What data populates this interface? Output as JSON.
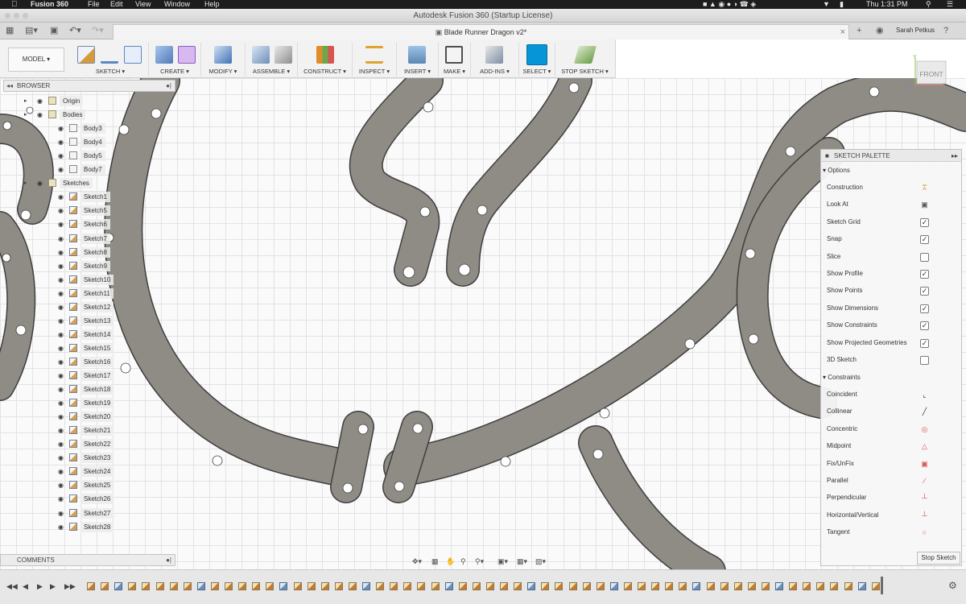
{
  "menubar": {
    "app_name": "Fusion 360",
    "menus": [
      "File",
      "Edit",
      "View",
      "Window",
      "Help"
    ],
    "clock": "Thu 1:31 PM"
  },
  "window": {
    "title": "Autodesk Fusion 360 (Startup License)"
  },
  "tabbar": {
    "document_tab": "Blade Runner Dragon v2*",
    "user_name": "Sarah Petkus"
  },
  "toolbar": {
    "workspace": "MODEL",
    "groups": [
      "SKETCH",
      "CREATE",
      "MODIFY",
      "ASSEMBLE",
      "CONSTRUCT",
      "INSPECT",
      "INSERT",
      "MAKE",
      "ADD-INS",
      "SELECT",
      "STOP SKETCH"
    ]
  },
  "viewcube": {
    "face_label": "FRONT",
    "axis_y": "Y",
    "axis_z": "Z"
  },
  "browser": {
    "title": "BROWSER",
    "items": [
      {
        "label": "Origin",
        "kind": "folder",
        "level": 1
      },
      {
        "label": "Bodies",
        "kind": "folder",
        "level": 1
      },
      {
        "label": "Body3",
        "kind": "body",
        "level": 2
      },
      {
        "label": "Body4",
        "kind": "body",
        "level": 2
      },
      {
        "label": "Body5",
        "kind": "body",
        "level": 2
      },
      {
        "label": "Body7",
        "kind": "body",
        "level": 2
      },
      {
        "label": "Sketches",
        "kind": "folder",
        "level": 1
      },
      {
        "label": "Sketch1",
        "kind": "sketch",
        "level": 2
      },
      {
        "label": "Sketch5",
        "kind": "sketch",
        "level": 2
      },
      {
        "label": "Sketch6",
        "kind": "sketch",
        "level": 2
      },
      {
        "label": "Sketch7",
        "kind": "sketch",
        "level": 2
      },
      {
        "label": "Sketch8",
        "kind": "sketch",
        "level": 2
      },
      {
        "label": "Sketch9",
        "kind": "sketch",
        "level": 2
      },
      {
        "label": "Sketch10",
        "kind": "sketch",
        "level": 2
      },
      {
        "label": "Sketch11",
        "kind": "sketch",
        "level": 2
      },
      {
        "label": "Sketch12",
        "kind": "sketch",
        "level": 2
      },
      {
        "label": "Sketch13",
        "kind": "sketch",
        "level": 2
      },
      {
        "label": "Sketch14",
        "kind": "sketch",
        "level": 2
      },
      {
        "label": "Sketch15",
        "kind": "sketch",
        "level": 2
      },
      {
        "label": "Sketch16",
        "kind": "sketch",
        "level": 2
      },
      {
        "label": "Sketch17",
        "kind": "sketch",
        "level": 2
      },
      {
        "label": "Sketch18",
        "kind": "sketch",
        "level": 2
      },
      {
        "label": "Sketch19",
        "kind": "sketch",
        "level": 2
      },
      {
        "label": "Sketch20",
        "kind": "sketch",
        "level": 2
      },
      {
        "label": "Sketch21",
        "kind": "sketch",
        "level": 2
      },
      {
        "label": "Sketch22",
        "kind": "sketch",
        "level": 2
      },
      {
        "label": "Sketch23",
        "kind": "sketch",
        "level": 2
      },
      {
        "label": "Sketch24",
        "kind": "sketch",
        "level": 2
      },
      {
        "label": "Sketch25",
        "kind": "sketch",
        "level": 2
      },
      {
        "label": "Sketch26",
        "kind": "sketch",
        "level": 2
      },
      {
        "label": "Sketch27",
        "kind": "sketch",
        "level": 2
      },
      {
        "label": "Sketch28",
        "kind": "sketch",
        "level": 2
      }
    ]
  },
  "comments": {
    "title": "COMMENTS"
  },
  "sketch_palette": {
    "title": "SKETCH PALETTE",
    "options_title": "Options",
    "options": [
      {
        "label": "Construction",
        "control": "icon",
        "checked": false
      },
      {
        "label": "Look At",
        "control": "icon",
        "checked": false
      },
      {
        "label": "Sketch Grid",
        "control": "checkbox",
        "checked": true
      },
      {
        "label": "Snap",
        "control": "checkbox",
        "checked": true
      },
      {
        "label": "Slice",
        "control": "checkbox",
        "checked": false
      },
      {
        "label": "Show Profile",
        "control": "checkbox",
        "checked": true
      },
      {
        "label": "Show Points",
        "control": "checkbox",
        "checked": true
      },
      {
        "label": "Show Dimensions",
        "control": "checkbox",
        "checked": true
      },
      {
        "label": "Show Constraints",
        "control": "checkbox",
        "checked": true
      },
      {
        "label": "Show Projected Geometries",
        "control": "checkbox",
        "checked": true
      },
      {
        "label": "3D Sketch",
        "control": "checkbox",
        "checked": false
      }
    ],
    "constraints_title": "Constraints",
    "constraints": [
      "Coincident",
      "Collinear",
      "Concentric",
      "Midpoint",
      "Fix/UnFix",
      "Parallel",
      "Perpendicular",
      "Horizontal/Vertical",
      "Tangent"
    ],
    "stop_button": "Stop Sketch"
  },
  "colors": {
    "part_fill": "#8f8c85",
    "part_edge": "#3f3f3f",
    "accent": "#0696d7"
  }
}
